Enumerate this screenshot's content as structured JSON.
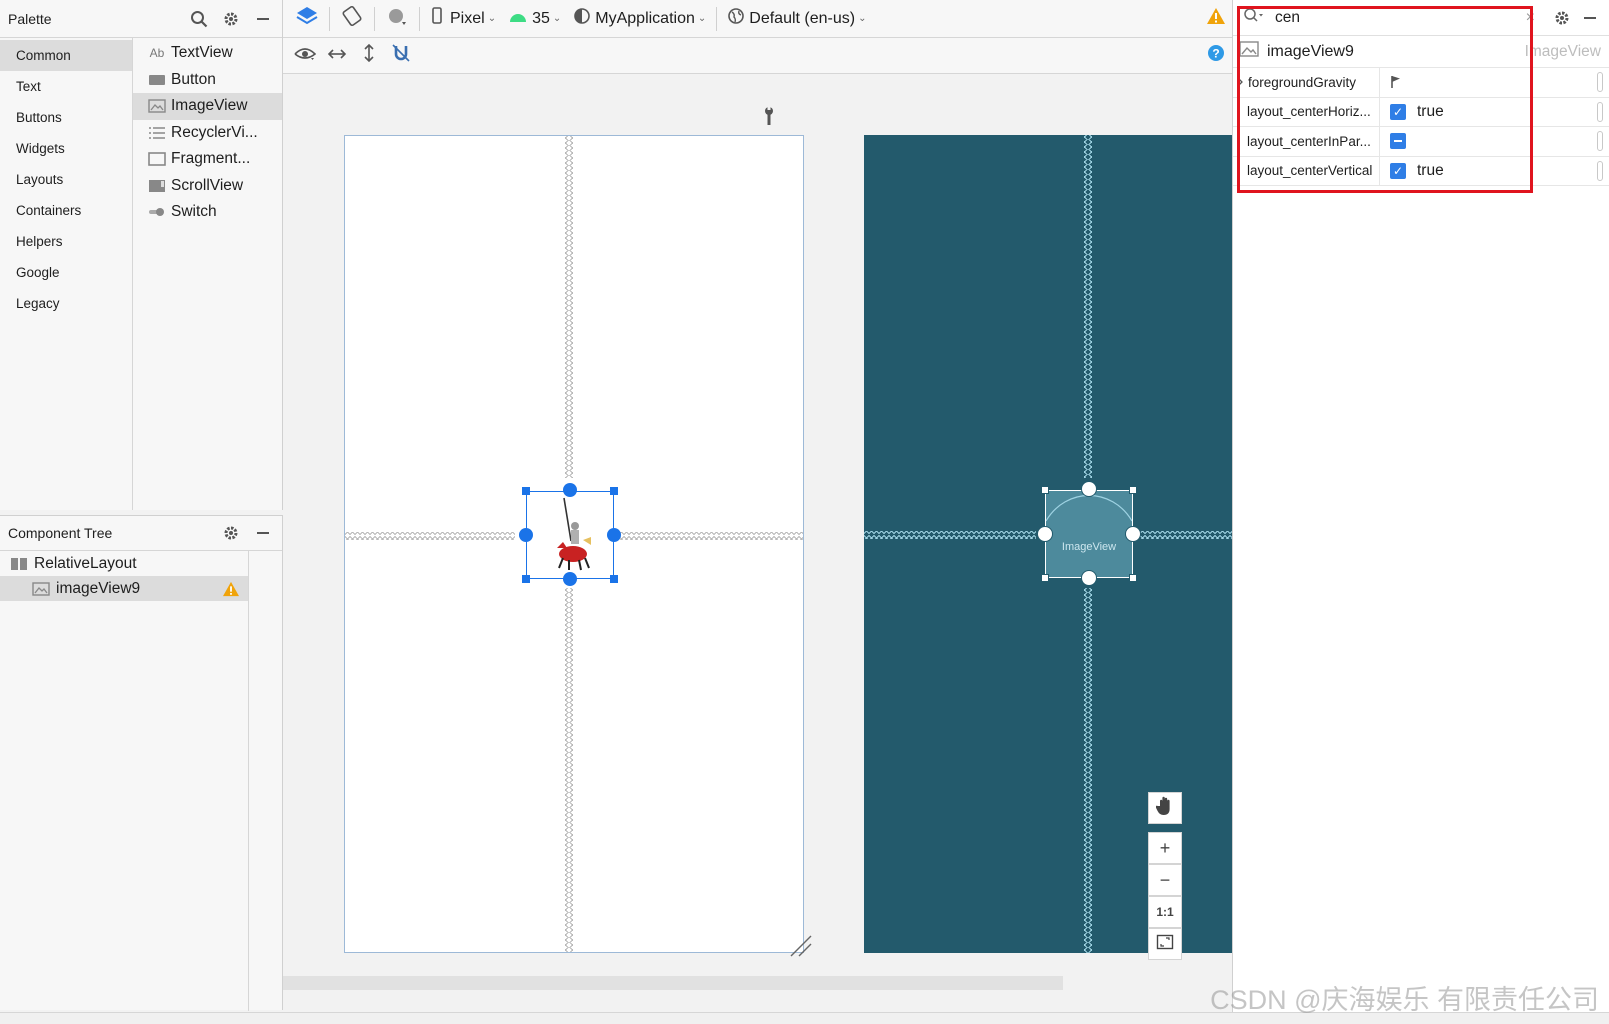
{
  "palette": {
    "title": "Palette",
    "categories": [
      "Common",
      "Text",
      "Buttons",
      "Widgets",
      "Layouts",
      "Containers",
      "Helpers",
      "Google",
      "Legacy"
    ],
    "selected_category": "Common",
    "widgets": [
      {
        "label": "TextView",
        "icon": "textview-icon",
        "glyph": "Ab"
      },
      {
        "label": "Button",
        "icon": "button-icon",
        "glyph": ""
      },
      {
        "label": "ImageView",
        "icon": "imageview-icon",
        "glyph": ""
      },
      {
        "label": "RecyclerVi...",
        "icon": "list-icon",
        "glyph": ""
      },
      {
        "label": "Fragment...",
        "icon": "fragment-icon",
        "glyph": ""
      },
      {
        "label": "ScrollView",
        "icon": "scrollview-icon",
        "glyph": ""
      },
      {
        "label": "Switch",
        "icon": "switch-icon",
        "glyph": ""
      }
    ],
    "selected_widget": "ImageView"
  },
  "component_tree": {
    "title": "Component Tree",
    "nodes": [
      {
        "label": "RelativeLayout",
        "depth": 0
      },
      {
        "label": "imageView9",
        "depth": 1,
        "warning": true
      }
    ]
  },
  "toolbar": {
    "device": "Pixel",
    "api_level": "35",
    "theme": "MyApplication",
    "locale": "Default (en-us)"
  },
  "blueprint": {
    "view_label": "ImageView"
  },
  "zoom_controls": {
    "zoom_in": "+",
    "zoom_out": "−",
    "actual_size": "1:1"
  },
  "attributes": {
    "search_value": "cen",
    "component_name": "imageView9",
    "component_type": "ImageView",
    "rows": [
      {
        "name": "foregroundGravity",
        "kind": "flag",
        "value": ""
      },
      {
        "name": "layout_centerHoriz...",
        "kind": "checked",
        "value": "true"
      },
      {
        "name": "layout_centerInPar...",
        "kind": "indeterminate",
        "value": ""
      },
      {
        "name": "layout_centerVertical",
        "kind": "checked",
        "value": "true"
      }
    ]
  },
  "watermark": "CSDN @庆海娱乐 有限责任公司",
  "colors": {
    "accent": "#1a73e8",
    "blueprint_bg": "#235a6c",
    "highlight_border": "#e0141e",
    "warning": "#f0a30a"
  }
}
